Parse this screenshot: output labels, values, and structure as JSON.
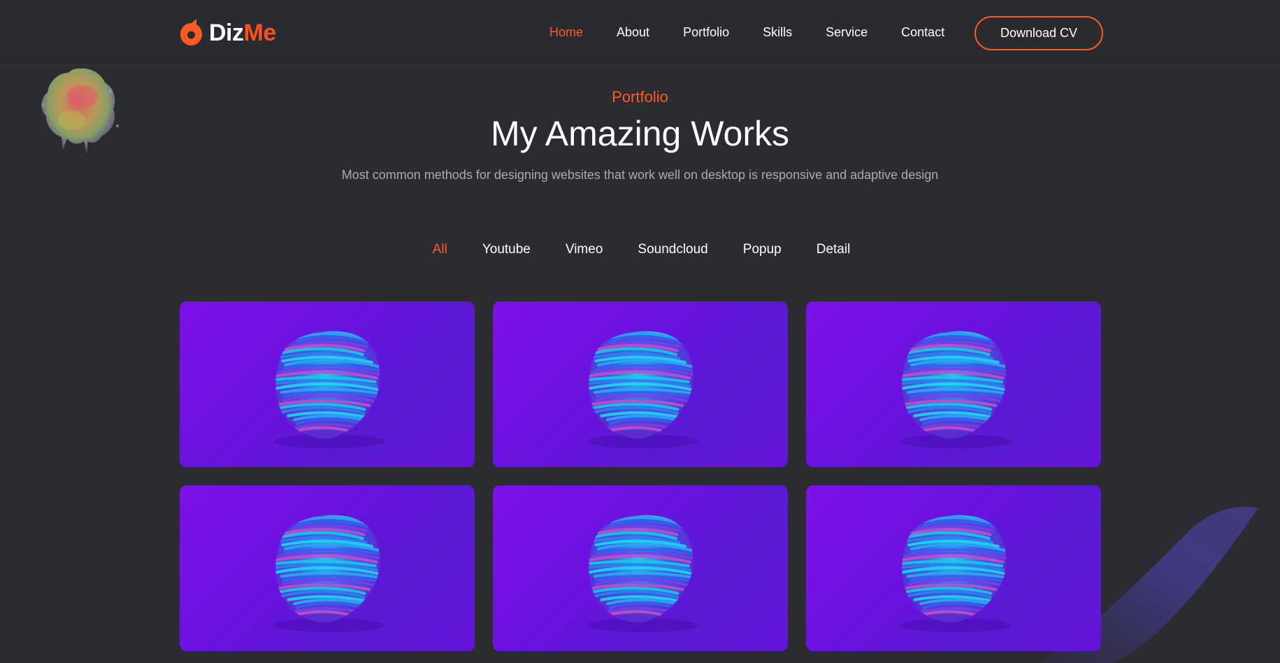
{
  "brand": {
    "name_part1": "Diz",
    "name_part2": "Me",
    "accent": "#ff5a24"
  },
  "nav": {
    "items": [
      {
        "label": "Home",
        "active": true
      },
      {
        "label": "About",
        "active": false
      },
      {
        "label": "Portfolio",
        "active": false
      },
      {
        "label": "Skills",
        "active": false
      },
      {
        "label": "Service",
        "active": false
      },
      {
        "label": "Contact",
        "active": false
      }
    ],
    "cta_label": "Download CV"
  },
  "section": {
    "eyebrow": "Portfolio",
    "title": "My Amazing Works",
    "subtitle": "Most common methods for designing websites that work well on desktop is responsive and adaptive design"
  },
  "filters": [
    {
      "label": "All",
      "active": true
    },
    {
      "label": "Youtube",
      "active": false
    },
    {
      "label": "Vimeo",
      "active": false
    },
    {
      "label": "Soundcloud",
      "active": false
    },
    {
      "label": "Popup",
      "active": false
    },
    {
      "label": "Detail",
      "active": false
    }
  ],
  "portfolio": {
    "items": [
      {
        "image": "purple-blue-abstract-sphere"
      },
      {
        "image": "purple-blue-abstract-sphere"
      },
      {
        "image": "purple-blue-abstract-sphere"
      },
      {
        "image": "purple-blue-abstract-sphere"
      },
      {
        "image": "purple-blue-abstract-sphere"
      },
      {
        "image": "purple-blue-abstract-sphere"
      }
    ]
  },
  "colors": {
    "background": "#2b2c31",
    "accent": "#ff5a24",
    "card_purple": "#7d10e8"
  }
}
